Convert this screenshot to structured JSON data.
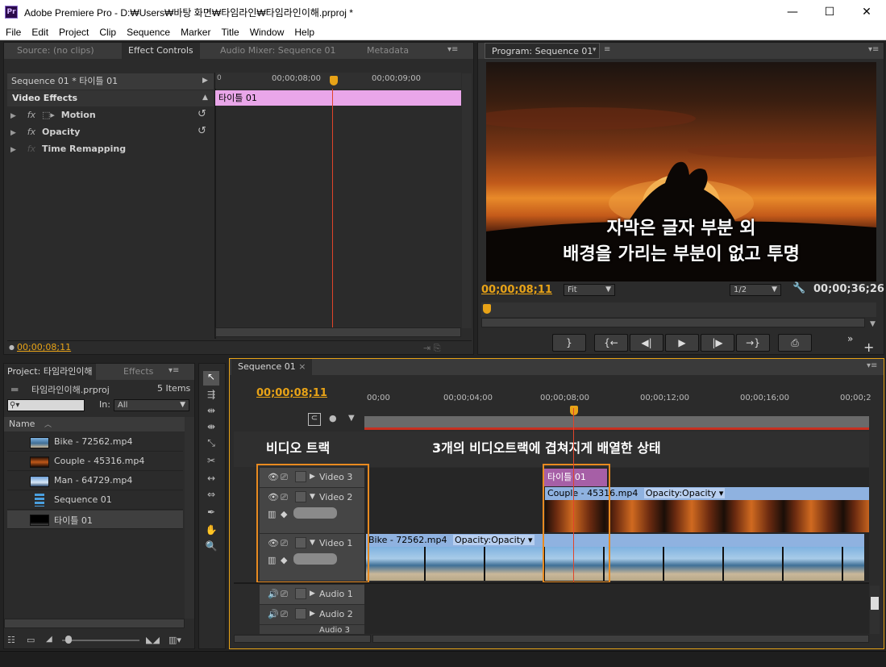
{
  "window": {
    "title": "Adobe Premiere Pro - D:₩Users₩바탕 화면₩타임라인₩타임라인이해.prproj *",
    "logo": "Pr",
    "minimize": "—",
    "maximize": "☐",
    "close": "✕"
  },
  "menu": [
    "File",
    "Edit",
    "Project",
    "Clip",
    "Sequence",
    "Marker",
    "Title",
    "Window",
    "Help"
  ],
  "source_panel": {
    "tabs": [
      "Source: (no clips)",
      "Effect Controls",
      "Audio Mixer: Sequence 01",
      "Metadata"
    ],
    "active_tab": "Effect Controls",
    "sequence_name": "Sequence 01 * 타이틀 01",
    "ruler_ticks": [
      "00;00;08;00",
      "00;00;09;00"
    ],
    "clip_label": "타이틀 01",
    "section": "Video Effects",
    "effects": [
      {
        "label": "Motion"
      },
      {
        "label": "Opacity"
      },
      {
        "label": "Time Remapping"
      }
    ],
    "fx": "fx",
    "timecode": "00;00;08;11"
  },
  "program_panel": {
    "tab": "Program: Sequence 01",
    "subtitle_line1": "자막은 글자 부분 외",
    "subtitle_line2": "배경을 가리는 부분이 없고 투명",
    "timecode": "00;00;08;11",
    "fit": "Fit",
    "resolution": "1/2",
    "duration": "00;00;36;26",
    "transport": [
      "}",
      "{←",
      "◀|",
      "▶",
      "|▶",
      "→}",
      "⎙"
    ]
  },
  "project_panel": {
    "tabs": [
      "Project: 타임라인이해",
      "Effects"
    ],
    "project_file": "타임라인이해.prproj",
    "item_count": "5 Items",
    "in_label": "In:",
    "in_value": "All",
    "column_name": "Name",
    "items": [
      {
        "name": "Bike - 72562.mp4",
        "thumb": "beach"
      },
      {
        "name": "Couple - 45316.mp4",
        "thumb": "sunset"
      },
      {
        "name": "Man - 64729.mp4",
        "thumb": "sky"
      },
      {
        "name": "Sequence 01",
        "thumb": "seq"
      },
      {
        "name": "타이틀 01",
        "thumb": "title"
      }
    ]
  },
  "timeline": {
    "tab": "Sequence 01",
    "timecode": "00;00;08;11",
    "ruler_ticks": [
      "00;00",
      "00;00;04;00",
      "00;00;08;00",
      "00;00;12;00",
      "00;00;16;00",
      "00;00;2"
    ],
    "annotation_tracks": "비디오 트랙",
    "annotation_overlap": "3개의 비디오트랙에 겹쳐지게 배열한 상태",
    "video_tracks": [
      "Video 3",
      "Video 2",
      "Video 1"
    ],
    "audio_tracks": [
      "Audio 1",
      "Audio 2",
      "Audio 3"
    ],
    "clips": {
      "title": "타이틀 01",
      "couple": "Couple - 45316.mp4",
      "couple_fx": "Opacity:Opacity ▾",
      "bike": "Bike - 72562.mp4",
      "bike_fx": "Opacity:Opacity ▾"
    }
  },
  "colors": {
    "accent_orange": "#e8a317",
    "title_clip": "#e9a6e9",
    "video_clip": "#8fb2e0",
    "playhead": "#e0442a"
  }
}
